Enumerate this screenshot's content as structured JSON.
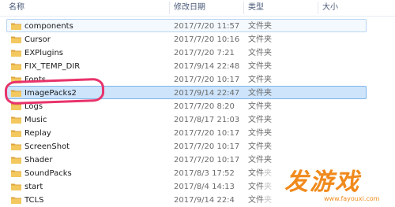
{
  "header": {
    "name": "名称",
    "date": "修改日期",
    "type": "类型",
    "size": "大小"
  },
  "files": [
    {
      "name": "components",
      "date": "2017/7/20 11:57",
      "type": "文件夹"
    },
    {
      "name": "Cursor",
      "date": "2017/7/20 10:16",
      "type": "文件夹"
    },
    {
      "name": "EXPlugins",
      "date": "2017/7/20 7:21",
      "type": "文件夹"
    },
    {
      "name": "FIX_TEMP_DIR",
      "date": "2017/9/14 22:48",
      "type": "文件夹"
    },
    {
      "name": "Fonts",
      "date": "2017/7/20 10:17",
      "type": "文件夹"
    },
    {
      "name": "ImagePacks2",
      "date": "2017/9/14 22:47",
      "type": "文件夹"
    },
    {
      "name": "Logs",
      "date": "2017/7/20 8:20",
      "type": "文件夹"
    },
    {
      "name": "Music",
      "date": "2017/8/17 21:03",
      "type": "文件夹"
    },
    {
      "name": "Replay",
      "date": "2017/7/20 10:17",
      "type": "文件夹"
    },
    {
      "name": "ScreenShot",
      "date": "2017/7/20 10:17",
      "type": "文件夹"
    },
    {
      "name": "Shader",
      "date": "2017/7/20 10:17",
      "type": "文件夹"
    },
    {
      "name": "SoundPacks",
      "date": "2017/8/3 17:52",
      "type": "文件夹"
    },
    {
      "name": "start",
      "date": "2017/8/4 14:13",
      "type": "文件夹"
    },
    {
      "name": "TCLS",
      "date": "2017/9/14 22:4",
      "type": "文件夹"
    }
  ],
  "watermark": {
    "text": "发游戏",
    "url": "www.fayouxi.com"
  },
  "colors": {
    "selection": "#cde4fb",
    "annotation": "#e8336b",
    "folder": "#e8b44c",
    "watermark": "#f08a1c"
  }
}
